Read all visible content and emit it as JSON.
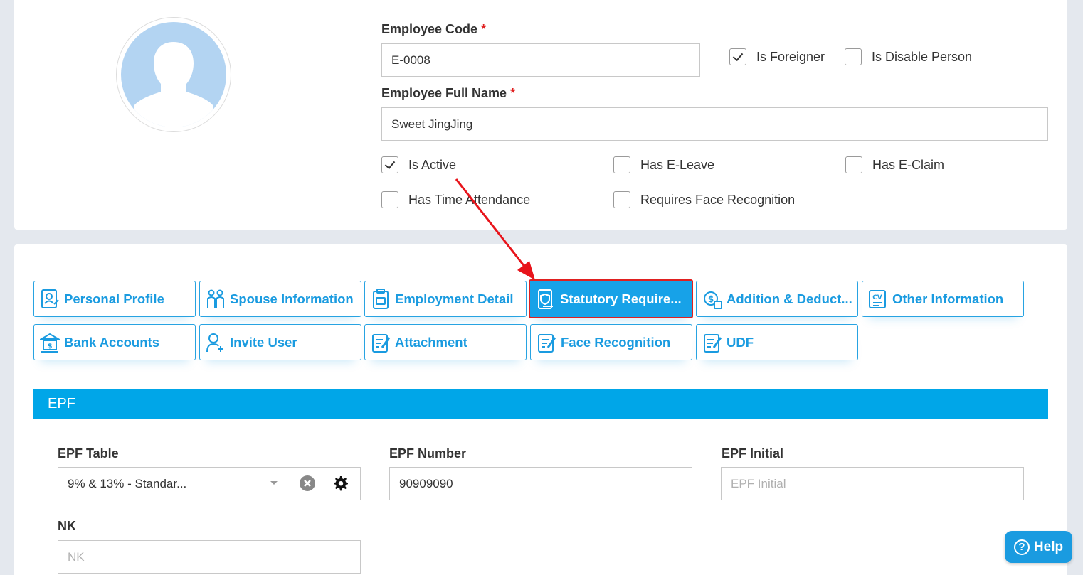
{
  "employee": {
    "code_label": "Employee Code",
    "code_value": "E-0008",
    "name_label": "Employee Full Name",
    "name_value": "Sweet JingJing",
    "required_mark": "*"
  },
  "flags": [
    {
      "label": "Is Foreigner",
      "checked": true
    },
    {
      "label": "Is Disable Person",
      "checked": false
    },
    {
      "label": "Is Active",
      "checked": true
    },
    {
      "label": "Has E-Leave",
      "checked": false
    },
    {
      "label": "Has E-Claim",
      "checked": false
    },
    {
      "label": "Has Time Attendance",
      "checked": false
    },
    {
      "label": "Requires Face Recognition",
      "checked": false
    }
  ],
  "tabs": [
    {
      "label": "Personal Profile",
      "icon": "profile-icon"
    },
    {
      "label": "Spouse Information",
      "icon": "couple-icon"
    },
    {
      "label": "Employment Detail",
      "icon": "clipboard-icon"
    },
    {
      "label": "Statutory Require...",
      "icon": "shield-document-icon",
      "active": true
    },
    {
      "label": "Addition & Deduct...",
      "icon": "money-icon"
    },
    {
      "label": "Other Information",
      "icon": "cv-icon"
    },
    {
      "label": "Bank Accounts",
      "icon": "bank-icon"
    },
    {
      "label": "Invite User",
      "icon": "add-user-icon"
    },
    {
      "label": "Attachment",
      "icon": "edit-document-icon"
    },
    {
      "label": "Face Recognition",
      "icon": "edit-document-icon"
    },
    {
      "label": "UDF",
      "icon": "edit-document-icon"
    }
  ],
  "epf": {
    "section_title": "EPF",
    "table_label": "EPF Table",
    "table_value": "9% & 13% - Standar...",
    "number_label": "EPF Number",
    "number_value": "90909090",
    "initial_label": "EPF Initial",
    "initial_placeholder": "EPF Initial",
    "nk_label": "NK",
    "nk_placeholder": "NK"
  },
  "help_label": "Help",
  "colors": {
    "accent": "#1a9be0",
    "section_header": "#00a6e8",
    "required": "#e02020",
    "annotation_arrow": "#e8141b"
  }
}
